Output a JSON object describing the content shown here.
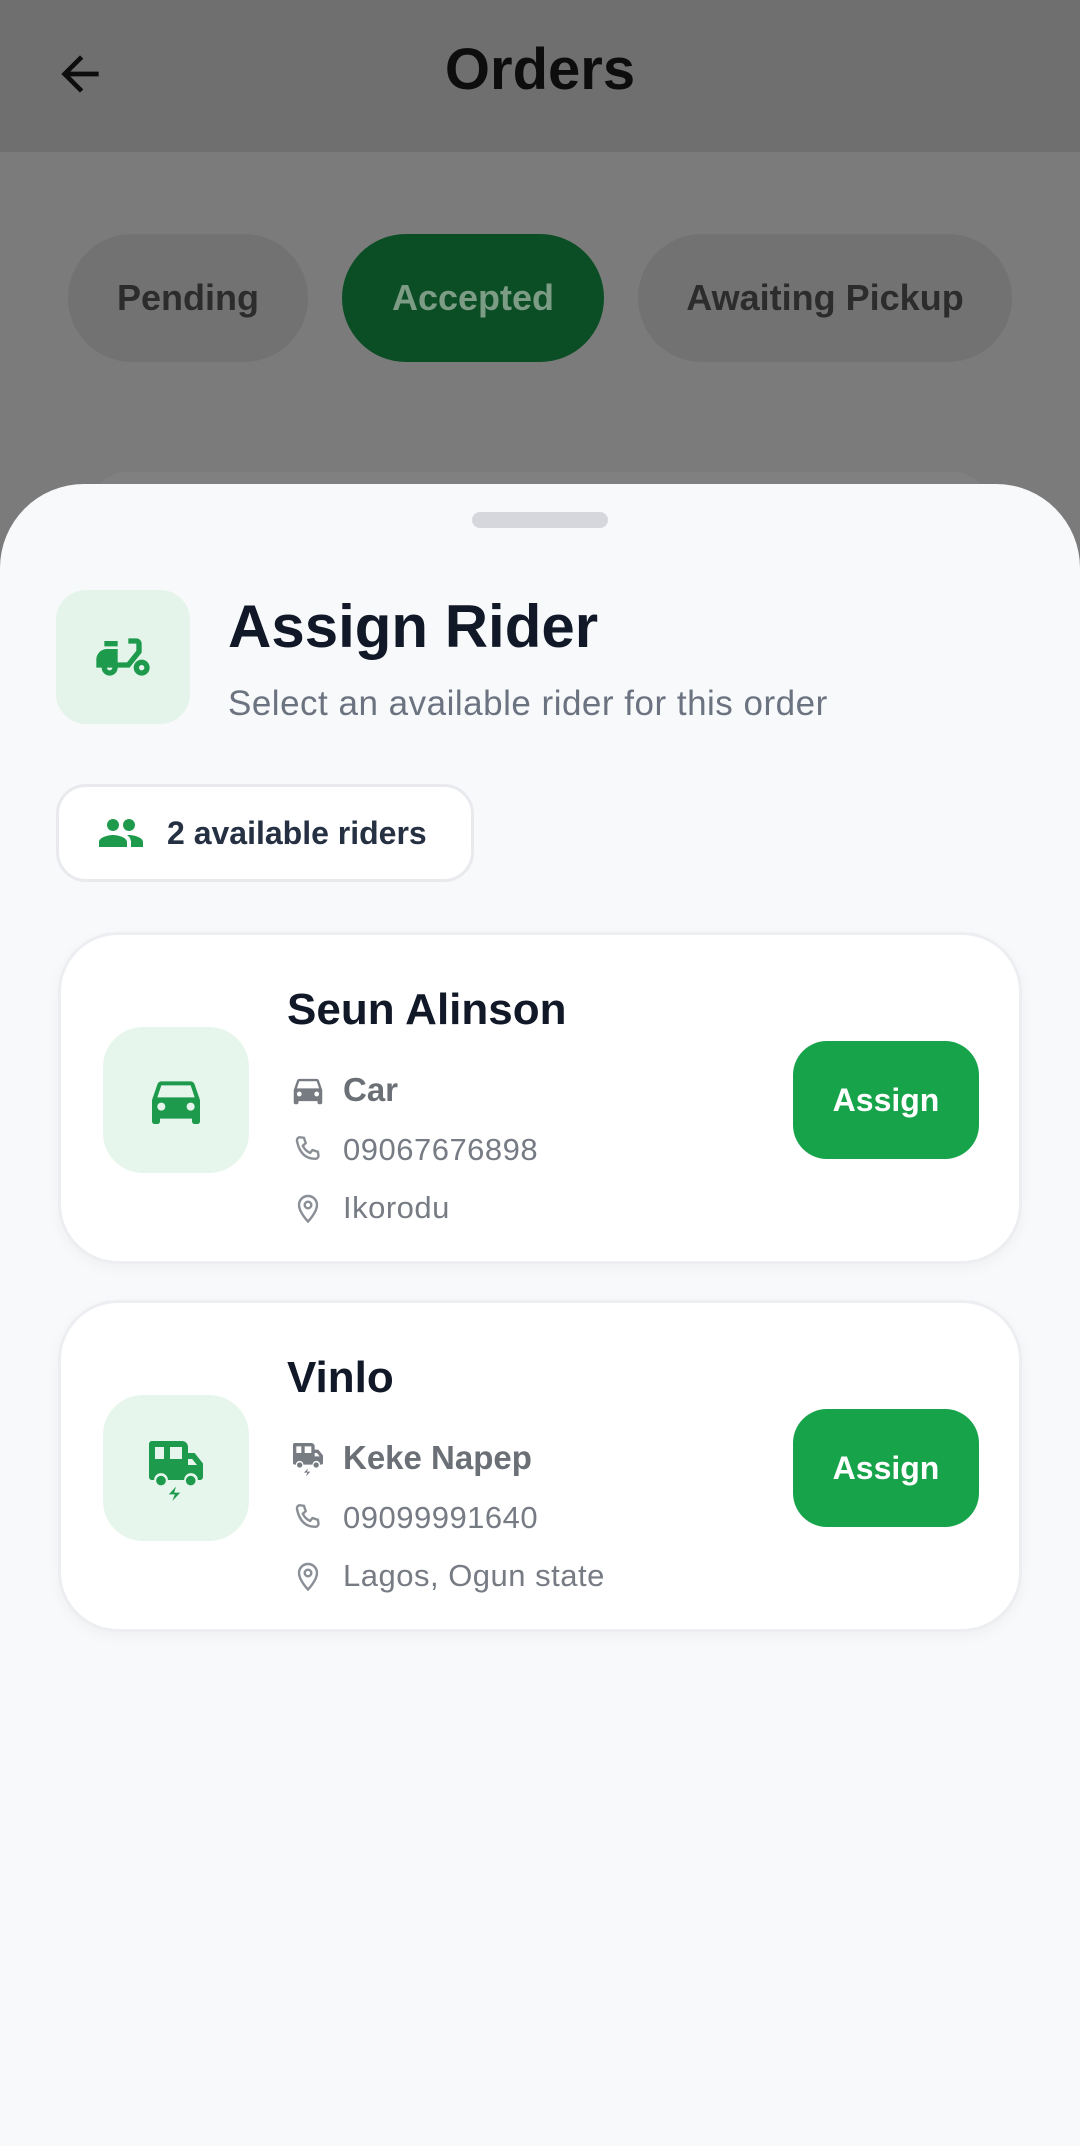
{
  "app_bar": {
    "title": "Orders"
  },
  "tabs": [
    {
      "label": "Pending",
      "active": false
    },
    {
      "label": "Accepted",
      "active": true
    },
    {
      "label": "Awaiting Pickup",
      "active": false
    }
  ],
  "sheet": {
    "title": "Assign Rider",
    "subtitle": "Select an available rider for this order",
    "available_count": "2 available riders",
    "riders": [
      {
        "name": "Seun Alinson",
        "vehicle": "Car",
        "vehicle_icon": "car-icon",
        "phone": "09067676898",
        "location": "Ikorodu",
        "assign_label": "Assign"
      },
      {
        "name": "Vinlo",
        "vehicle": "Keke Napep",
        "vehicle_icon": "electric-rickshaw-icon",
        "phone": "09099991640",
        "location": "Lagos, Ogun state",
        "assign_label": "Assign"
      }
    ]
  },
  "colors": {
    "accent": "#17a34a",
    "accent_dark": "#0b4d24",
    "icon_bg": "#e6f6ec",
    "text_primary": "#111827",
    "text_muted": "#6b7280"
  }
}
